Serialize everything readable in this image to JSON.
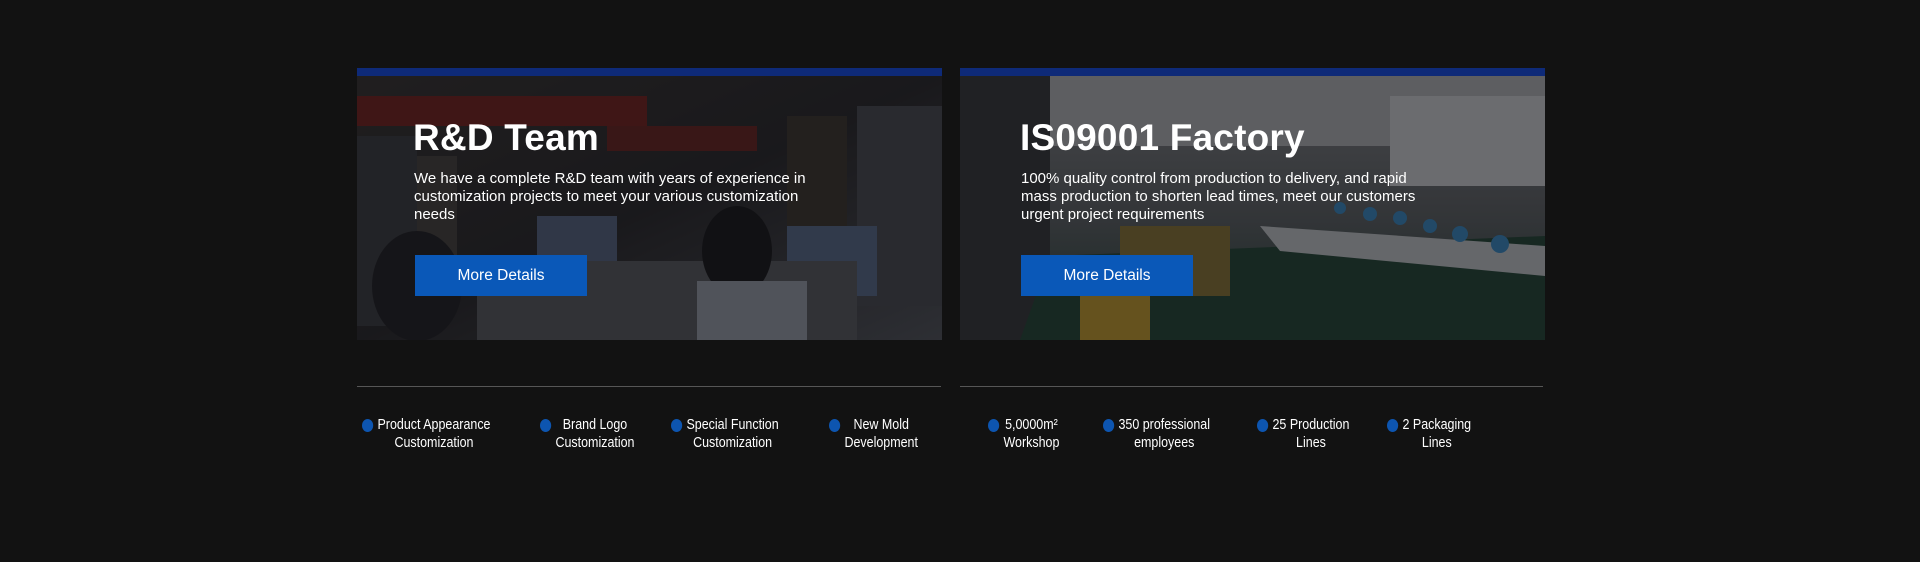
{
  "colors": {
    "background": "#121212",
    "accent_bar": "#0e2a78",
    "button": "#0a58b8",
    "bullet": "#0d55b0",
    "divider": "#565656"
  },
  "rd_card": {
    "title": "R&D Team",
    "description": "We have a complete R&D team with years of experience in customization projects to meet your various customization needs",
    "button_label": "More Details",
    "image": "office-photo"
  },
  "factory_card": {
    "title": "IS09001 Factory",
    "description": "100% quality control from production to delivery, and rapid mass production to shorten lead times, meet our customers urgent project requirements",
    "button_label": "More Details",
    "image": "factory-photo"
  },
  "rd_features": [
    {
      "line1": "Product Appearance",
      "line2": "Customization"
    },
    {
      "line1": "Brand Logo",
      "line2": "Customization"
    },
    {
      "line1": "Special Function",
      "line2": "Customization"
    },
    {
      "line1": "New Mold",
      "line2": "Development"
    }
  ],
  "factory_features": [
    {
      "line1": "5,0000m²",
      "line2": "Workshop"
    },
    {
      "line1": "350 professional",
      "line2": "employees"
    },
    {
      "line1": "25 Production",
      "line2": "Lines"
    },
    {
      "line1": "2 Packaging",
      "line2": "Lines"
    }
  ]
}
